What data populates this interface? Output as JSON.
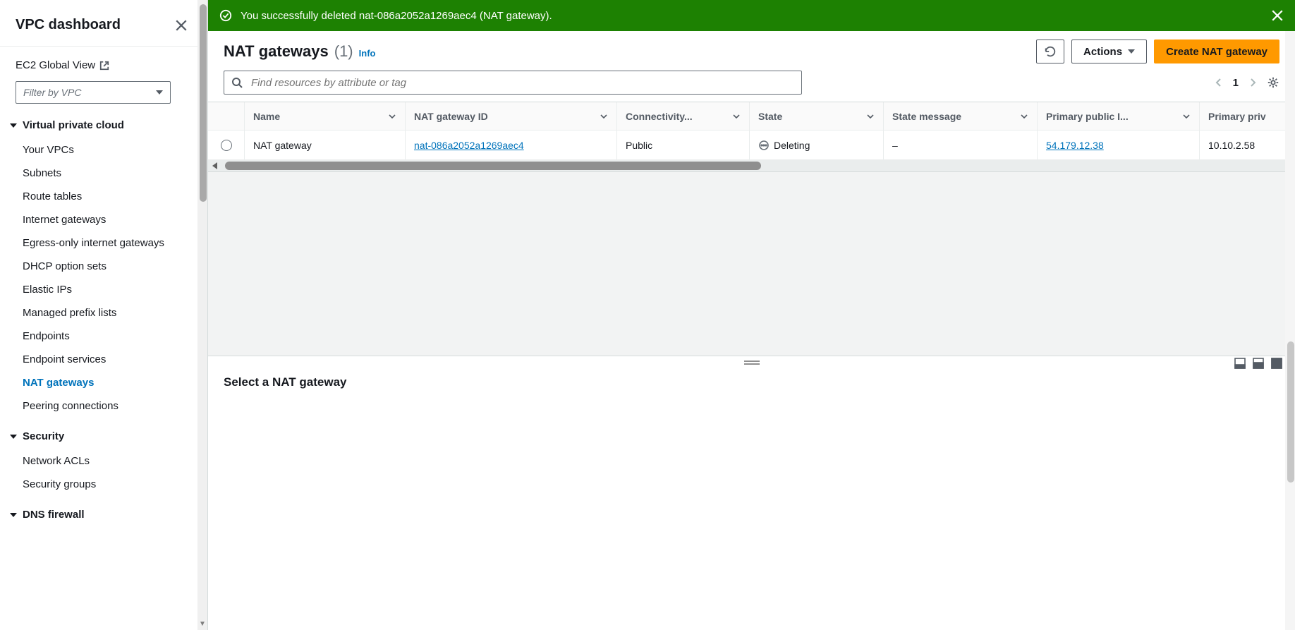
{
  "sidebar": {
    "title": "VPC dashboard",
    "ec2_link": "EC2 Global View",
    "filter_placeholder": "Filter by VPC",
    "sections": {
      "vpc": {
        "header": "Virtual private cloud",
        "items": [
          "Your VPCs",
          "Subnets",
          "Route tables",
          "Internet gateways",
          "Egress-only internet gateways",
          "DHCP option sets",
          "Elastic IPs",
          "Managed prefix lists",
          "Endpoints",
          "Endpoint services",
          "NAT gateways",
          "Peering connections"
        ]
      },
      "security": {
        "header": "Security",
        "items": [
          "Network ACLs",
          "Security groups"
        ]
      },
      "dnsfw": {
        "header": "DNS firewall"
      }
    },
    "active_item": "NAT gateways"
  },
  "flash": {
    "message": "You successfully deleted nat-086a2052a1269aec4 (NAT gateway)."
  },
  "header": {
    "title": "NAT gateways",
    "count": "(1)",
    "info": "Info",
    "actions_label": "Actions",
    "create_label": "Create NAT gateway"
  },
  "search": {
    "placeholder": "Find resources by attribute or tag"
  },
  "pagination": {
    "current": "1"
  },
  "table": {
    "columns": [
      "Name",
      "NAT gateway ID",
      "Connectivity...",
      "State",
      "State message",
      "Primary public I...",
      "Primary priv"
    ],
    "rows": [
      {
        "name": "NAT gateway",
        "nat_id": "nat-086a2052a1269aec4",
        "connectivity": "Public",
        "state": "Deleting",
        "state_message": "–",
        "public_ip": "54.179.12.38",
        "private_ip": "10.10.2.58"
      }
    ]
  },
  "detail": {
    "prompt": "Select a NAT gateway"
  }
}
